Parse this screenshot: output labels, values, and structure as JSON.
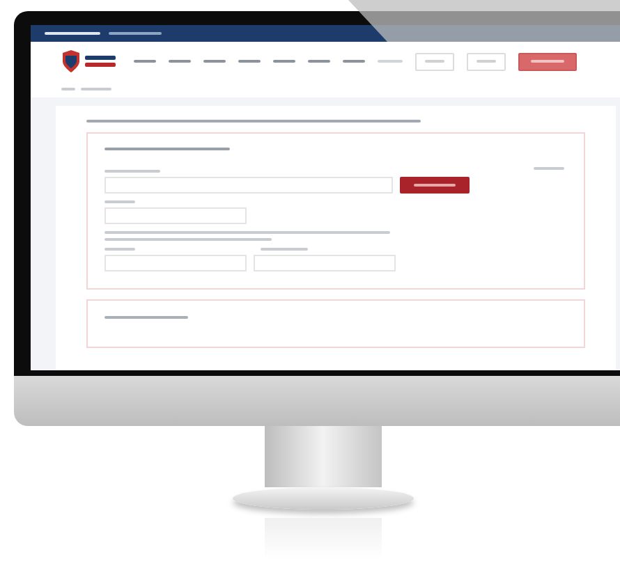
{
  "device": {
    "kind": "desktop-monitor"
  },
  "page": {
    "top_bar": {
      "kind": "dark"
    },
    "nav": [
      {
        "kind": "link"
      },
      {
        "kind": "link"
      },
      {
        "kind": "link"
      },
      {
        "kind": "link"
      },
      {
        "kind": "link"
      },
      {
        "kind": "link"
      },
      {
        "kind": "link"
      },
      {
        "kind": "muted"
      },
      {
        "kind": "outline"
      },
      {
        "kind": "outline"
      },
      {
        "kind": "filled"
      }
    ],
    "sections": [
      {
        "kind": "form",
        "rows": [
          {
            "kind": "wide"
          },
          {
            "kind": "narrow"
          },
          {
            "kind": "note"
          },
          {
            "kind": "pair"
          }
        ]
      },
      {
        "kind": "collapsed"
      }
    ]
  }
}
